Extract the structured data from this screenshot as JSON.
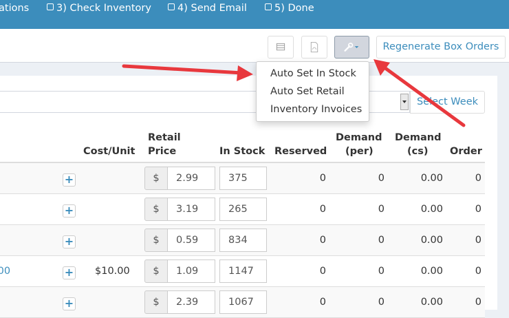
{
  "steps": [
    {
      "label": "ations",
      "checkbox": false
    },
    {
      "label": "3) Check Inventory",
      "checkbox": true
    },
    {
      "label": "4) Send Email",
      "checkbox": true
    },
    {
      "label": "5) Done",
      "checkbox": true
    }
  ],
  "toolbar": {
    "regen_label": "Regenerate Box Orders",
    "icons": [
      "spreadsheet-icon",
      "pdf-icon",
      "wrench-icon"
    ]
  },
  "dropdown": {
    "items": [
      "Auto Set In Stock",
      "Auto Set Retail",
      "Inventory Invoices"
    ]
  },
  "week": {
    "select_week_label": "Select Week"
  },
  "table": {
    "headers": {
      "cost_unit": "Cost/Unit",
      "retail_1": "Retail",
      "retail_2": "Price",
      "in_stock": "In Stock",
      "reserved": "Reserved",
      "demand_per_1": "Demand",
      "demand_per_2": "(per)",
      "demand_cs_1": "Demand",
      "demand_cs_2": "(cs)",
      "order": "Order"
    },
    "rows": [
      {
        "left_link": "",
        "cost_unit": "",
        "currency": "$",
        "retail": "2.99",
        "in_stock": "375",
        "reserved": "0",
        "demand_per": "0",
        "demand_cs": "0.00",
        "order": "0"
      },
      {
        "left_link": "",
        "cost_unit": "",
        "currency": "$",
        "retail": "3.19",
        "in_stock": "265",
        "reserved": "0",
        "demand_per": "0",
        "demand_cs": "0.00",
        "order": "0"
      },
      {
        "left_link": "",
        "cost_unit": "",
        "currency": "$",
        "retail": "0.59",
        "in_stock": "834",
        "reserved": "0",
        "demand_per": "0",
        "demand_cs": "0.00",
        "order": "0"
      },
      {
        "left_link": ".00",
        "cost_unit": "$10.00",
        "currency": "$",
        "retail": "1.09",
        "in_stock": "1147",
        "reserved": "0",
        "demand_per": "0",
        "demand_cs": "0.00",
        "order": "0"
      },
      {
        "left_link": "",
        "cost_unit": "",
        "currency": "$",
        "retail": "2.39",
        "in_stock": "1067",
        "reserved": "0",
        "demand_per": "0",
        "demand_cs": "0.00",
        "order": "0"
      }
    ]
  },
  "colors": {
    "brand": "#3c8dbc",
    "arrow": "#e8383d"
  }
}
